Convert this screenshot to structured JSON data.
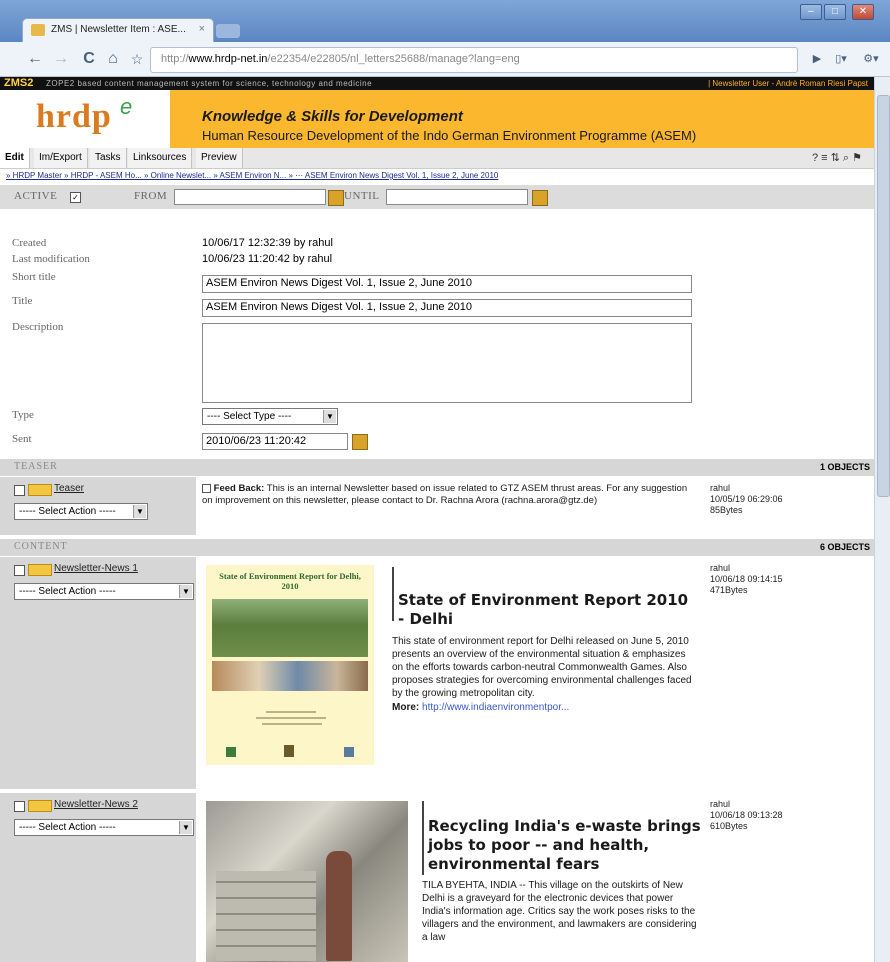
{
  "browser": {
    "tab_title": "ZMS | Newsletter Item : ASE...",
    "tab_close": "×",
    "url_prefix": "http://",
    "url_host": "www.hrdp-net.in",
    "url_path": "/e22354/e22805/nl_letters25688/manage?lang=eng",
    "back_icon": "←",
    "forward_icon": "→",
    "reload_icon": "C",
    "home_icon": "⌂",
    "star_icon": "☆",
    "go_icon": "▶",
    "page_menu_icon": "▯▾",
    "tools_menu_icon": "⚙▾",
    "win_min": "–",
    "win_max": "□",
    "win_close": "✕"
  },
  "zms": {
    "brand": "ZMS2",
    "subtitle": "ZOPE2 based content management system for science, technology and medicine",
    "user_info": "| Newsletter User - Andrè Roman Riesi Papst"
  },
  "header": {
    "logo": "hrdp",
    "logo_accent": "e",
    "tagline": "Knowledge & Skills for Development",
    "subtagline": "Human Resource Development of the Indo German Environment Programme (ASEM)"
  },
  "tabs": [
    "Edit",
    "Im/Export",
    "Tasks",
    "Linksources",
    "Preview"
  ],
  "tab_icons": "? ≡ ⇅ ⌕ ⚑",
  "breadcrumb": "» HRDP Master » HRDP - ASEM Ho... » Online Newslet... » ASEM Environ N... » ⋯ ASEM Environ News Digest Vol. 1, Issue 2, June 2010",
  "active_bar": {
    "active_label": "ACTIVE",
    "from_label": "FROM",
    "until_label": "UNTIL"
  },
  "form": {
    "created_label": "Created",
    "created_value": "10/06/17 12:32:39 by rahul",
    "modified_label": "Last modification",
    "modified_value": "10/06/23 11:20:42 by rahul",
    "short_title_label": "Short title",
    "short_title_value": "ASEM Environ News Digest Vol. 1, Issue 2, June 2010",
    "title_label": "Title",
    "title_value": "ASEM Environ News Digest Vol. 1, Issue 2, June 2010",
    "description_label": "Description",
    "type_label": "Type",
    "type_value": "---- Select Type ----",
    "sent_label": "Sent",
    "sent_value": "2010/06/23 11:20:42"
  },
  "teaser": {
    "section": "TEASER",
    "count": "1 OBJECTS",
    "link": "Teaser",
    "action": "----- Select Action -----",
    "text_bold": "Feed Back:",
    "text": "This is an internal Newsletter based on issue related to GTZ ASEM thrust areas. For any suggestion on improvement on this newsletter, please contact to Dr. Rachna Arora (rachna.arora@gtz.de)",
    "meta_user": "rahul",
    "meta_date": "10/05/19 06:29:06",
    "meta_size": "85Bytes"
  },
  "content": {
    "section": "CONTENT",
    "count": "6 OBJECTS",
    "items": [
      {
        "link": "Newsletter-News 1",
        "action": "----- Select Action -----",
        "cover_title": "State of Environment Report for Delhi, 2010",
        "headline": "State of Environment Report 2010 - Delhi",
        "body": "This state of environment report for Delhi released on June 5, 2010 presents an overview of the environmental situation & emphasizes on the efforts towards carbon-neutral Commonwealth Games. Also proposes strategies for overcoming environmental challenges faced by the growing metropolitan city.",
        "more_label": "More:",
        "more_link": "http://www.indiaenvironmentpor...",
        "meta_user": "rahul",
        "meta_date": "10/06/18 09:14:15",
        "meta_size": "471Bytes"
      },
      {
        "link": "Newsletter-News 2",
        "action": "----- Select Action -----",
        "headline": "Recycling India's e-waste brings jobs to poor -- and health, environmental fears",
        "body": "TILA BYEHTA, INDIA -- This village on the outskirts of New Delhi is a graveyard for the electronic devices that power India's information age. Critics say the work poses risks to the villagers and the environment, and lawmakers are considering a law",
        "meta_user": "rahul",
        "meta_date": "10/06/18 09:13:28",
        "meta_size": "610Bytes"
      }
    ]
  }
}
